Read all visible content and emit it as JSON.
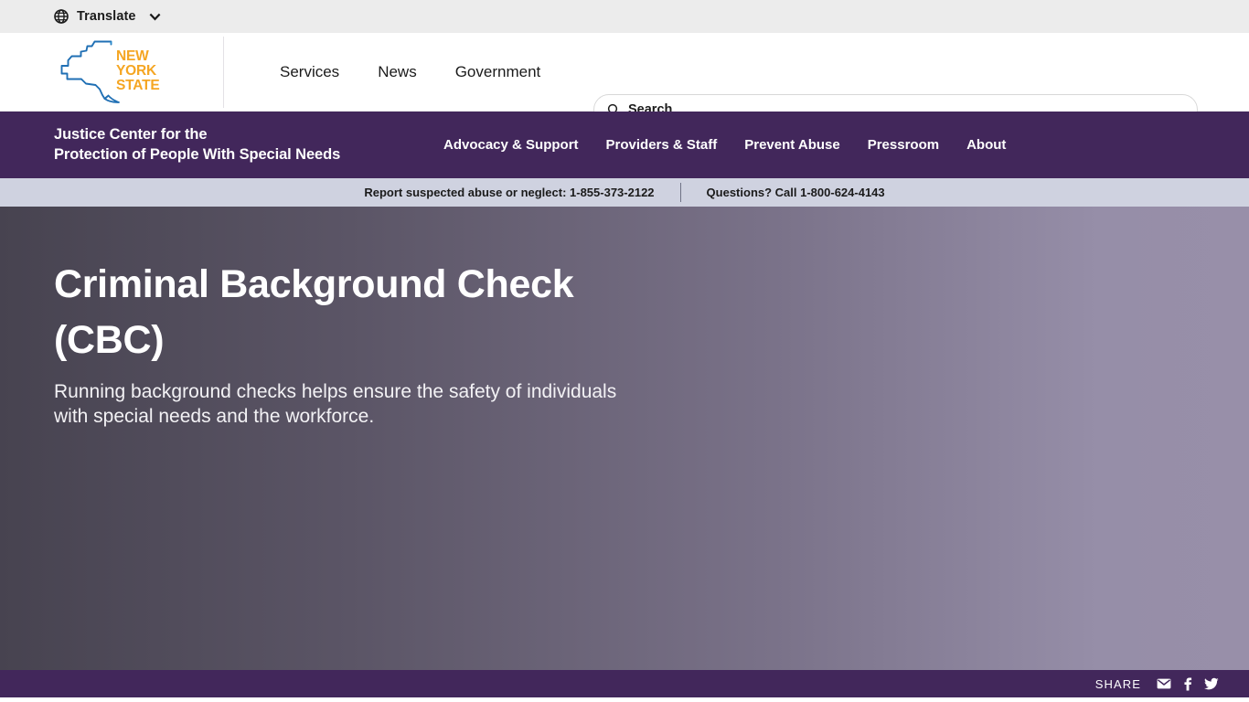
{
  "translate_bar": {
    "globe_icon": "globe-icon",
    "label": "Translate",
    "chevron_icon": "chevron-down-icon"
  },
  "nygov_header": {
    "logo_alt": "New York State",
    "logo_text_lines": [
      "NEW",
      "YORK",
      "STATE"
    ],
    "nav_items": [
      {
        "label": "Services"
      },
      {
        "label": "News"
      },
      {
        "label": "Government"
      }
    ],
    "search": {
      "icon": "search-icon",
      "placeholder": "Search",
      "value": ""
    }
  },
  "agency_band": {
    "title_line1": "Justice Center for the",
    "title_line2": "Protection of People With Special Needs",
    "nav_items": [
      {
        "label": "Advocacy & Support"
      },
      {
        "label": "Providers & Staff"
      },
      {
        "label": "Prevent Abuse"
      },
      {
        "label": "Pressroom"
      },
      {
        "label": "About"
      }
    ]
  },
  "hotline_bar": {
    "left_text": "Report suspected abuse or neglect: 1-855-373-2122",
    "right_text": "Questions? Call 1-800-624-4143"
  },
  "hero": {
    "title": "Criminal Background Check (CBC)",
    "subtitle": "Running background checks helps ensure the safety of individuals with special needs and the workforce."
  },
  "share_bar": {
    "label": "SHARE",
    "icons": [
      {
        "name": "email-icon"
      },
      {
        "name": "facebook-icon"
      },
      {
        "name": "twitter-icon"
      }
    ]
  },
  "colors": {
    "agency_purple": "#42275b",
    "hotline_bg": "#cfd2e0",
    "translate_bg": "#ececec",
    "hero_gradient_start": "#474350",
    "hero_gradient_end": "#968ea8",
    "logo_orange": "#f5a623",
    "logo_blue": "#1f6fb4"
  }
}
